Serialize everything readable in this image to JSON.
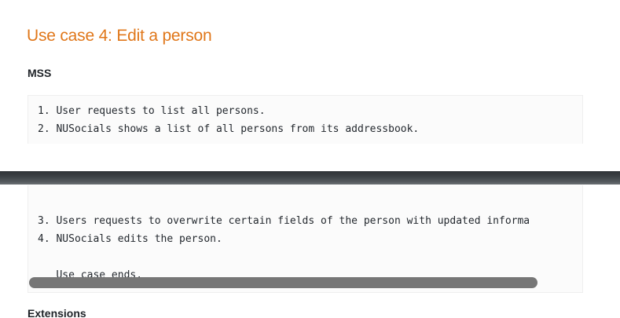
{
  "section": {
    "heading": "Use case 4: Edit a person",
    "mss_label": "MSS",
    "extensions_label": "Extensions"
  },
  "steps_top": [
    "1. User requests to list all persons.",
    "2. NUSocials shows a list of all persons from its addressbook."
  ],
  "steps_bottom": [
    "3. Users requests to overwrite certain fields of the person with updated informa",
    "4. NUSocials edits the person.",
    "   Use case ends."
  ],
  "colors": {
    "heading": "#e0771a",
    "divider": "#3c4145",
    "scrollbar": "#767676"
  }
}
